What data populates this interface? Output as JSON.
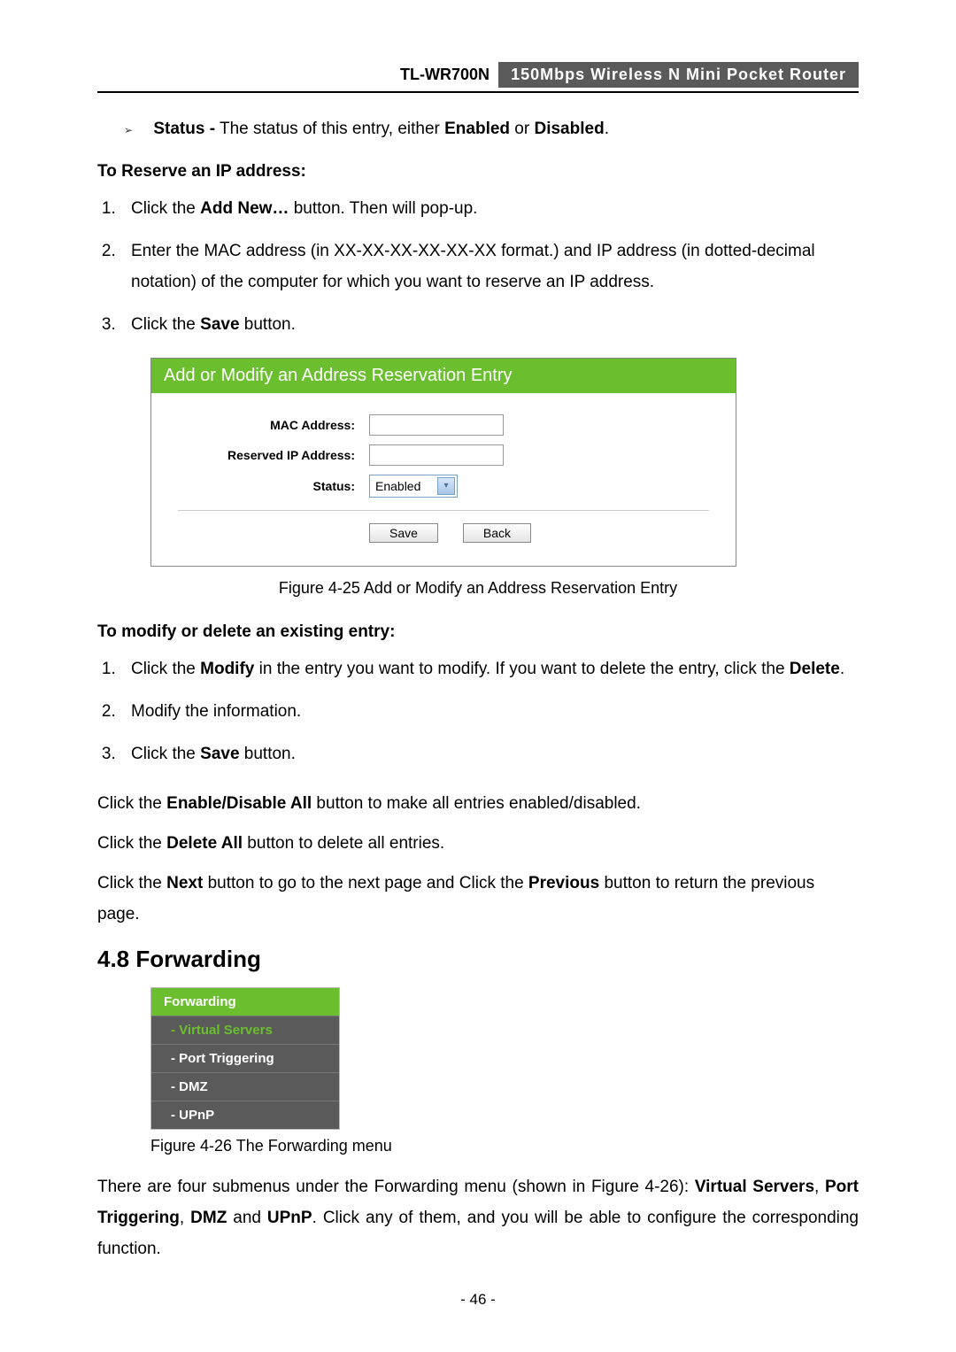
{
  "header": {
    "model": "TL-WR700N",
    "description": "150Mbps Wireless N Mini Pocket Router"
  },
  "bullet1": {
    "label": "Status -",
    "text": " The status of this entry, either ",
    "opt1": "Enabled",
    "mid": " or ",
    "opt2": "Disabled",
    "end": "."
  },
  "reserve": {
    "heading": "To Reserve an IP address:",
    "step1_a": "Click the ",
    "step1_b": "Add New…",
    "step1_c": " button. Then will pop-up.",
    "step2": "Enter the MAC address (in XX-XX-XX-XX-XX-XX format.) and IP address (in dotted-decimal notation) of the computer for which you want to reserve an IP address.",
    "step3_a": "Click the ",
    "step3_b": "Save",
    "step3_c": " button."
  },
  "figure25": {
    "title": "Add or Modify an Address Reservation Entry",
    "mac_label": "MAC Address:",
    "ip_label": "Reserved IP Address:",
    "status_label": "Status:",
    "status_value": "Enabled",
    "save_btn": "Save",
    "back_btn": "Back",
    "caption": "Figure 4-25 Add or Modify an Address Reservation Entry"
  },
  "modify": {
    "heading": "To modify or delete an existing entry:",
    "step1_a": "Click the ",
    "step1_b": "Modify",
    "step1_c": " in the entry you want to modify. If you want to delete the entry, click the ",
    "step1_d": "Delete",
    "step1_e": ".",
    "step2": "Modify the information.",
    "step3_a": "Click the ",
    "step3_b": "Save",
    "step3_c": " button."
  },
  "paras": {
    "p1_a": "Click the ",
    "p1_b": "Enable/Disable All",
    "p1_c": " button to make all entries enabled/disabled.",
    "p2_a": "Click the ",
    "p2_b": "Delete All",
    "p2_c": " button to delete all entries.",
    "p3_a": "Click the ",
    "p3_b": "Next",
    "p3_c": " button to go to the next page and Click the ",
    "p3_d": "Previous",
    "p3_e": " button to return the previous page."
  },
  "section48": {
    "title": "4.8  Forwarding"
  },
  "menu": {
    "head": "Forwarding",
    "item1": "- Virtual Servers",
    "item2": "- Port Triggering",
    "item3": "- DMZ",
    "item4": "- UPnP",
    "caption": "Figure 4-26 The Forwarding menu"
  },
  "forwarding_desc": {
    "a": "There are four submenus under the Forwarding menu (shown in Figure 4-26): ",
    "b": "Virtual Servers",
    "c": ", ",
    "d": "Port Triggering",
    "e": ", ",
    "f": "DMZ",
    "g": " and ",
    "h": "UPnP",
    "i": ". Click any of them, and you will be able to configure the corresponding function."
  },
  "pagenum": "- 46 -"
}
